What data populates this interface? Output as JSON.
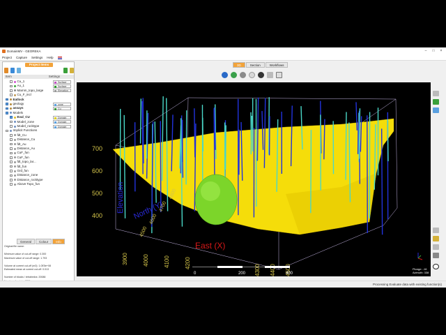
{
  "titlebar": {
    "title": "DomainMV - GEOREKA"
  },
  "menu": [
    "Project",
    "Capture",
    "Settings",
    "Help"
  ],
  "project_items": {
    "header": "Project Items"
  },
  "tree_columns": {
    "item": "Item",
    "settings": "Settings"
  },
  "tree": [
    {
      "label": "Cu_1",
      "checked": false,
      "indent": 1,
      "color": "#d24fd2",
      "setting": "Surface",
      "swatch": "#c050c0"
    },
    {
      "label": "Au_1",
      "checked": false,
      "indent": 1,
      "color": "#3aa83a",
      "setting": "Surface",
      "swatch": "#2a9a2a"
    },
    {
      "label": "Marnm_topo_large",
      "checked": false,
      "indent": 1,
      "color": "#8a8a8a",
      "setting": "Elevation",
      "swatch": "#999"
    },
    {
      "label": "Cu_F_incl",
      "checked": false,
      "indent": 1,
      "color": "#c29a55",
      "setting": "",
      "swatch": ""
    },
    {
      "label": "Eatlock",
      "checked": true,
      "indent": 0,
      "color": "#b58a3a",
      "bold": true,
      "setting": "",
      "swatch": ""
    },
    {
      "label": "geology",
      "checked": true,
      "indent": 0,
      "color": "#b58a3a",
      "setting": "zone",
      "swatch": "#5aa0e0"
    },
    {
      "label": "assays",
      "checked": true,
      "indent": 0,
      "color": "#b58a3a",
      "bold": true,
      "setting": "Cu",
      "swatch": "#3a9a3a"
    },
    {
      "label": "Models",
      "checked": true,
      "indent": 0,
      "color": "#6f8fc0",
      "setting": "",
      "swatch": ""
    },
    {
      "label": "Eval_CU",
      "checked": true,
      "indent": 1,
      "color": "#e0c030",
      "bold": true,
      "setting": "Domain",
      "swatch": "#e0d020"
    },
    {
      "label": "Model_zone",
      "checked": false,
      "indent": 1,
      "color": "#6f8fc0",
      "setting": "Domain",
      "swatch": "#5aa0e0"
    },
    {
      "label": "Model_rocktype",
      "checked": false,
      "indent": 1,
      "color": "#6f8fc0",
      "setting": "Domain",
      "swatch": "#5aa0e0"
    },
    {
      "label": "Implicit Functions",
      "checked": false,
      "indent": 0,
      "color": "#6f8fc0",
      "setting": "",
      "swatch": ""
    },
    {
      "label": "fdt_Cu",
      "checked": false,
      "indent": 1,
      "color": "#9a9a9a",
      "setting": "",
      "swatch": ""
    },
    {
      "label": "Distance_Cu",
      "checked": false,
      "indent": 1,
      "color": "#9a9a9a",
      "setting": "",
      "swatch": ""
    },
    {
      "label": "fdt_Au",
      "checked": false,
      "indent": 1,
      "color": "#9a9a9a",
      "setting": "",
      "swatch": ""
    },
    {
      "label": "Distance_Au",
      "checked": false,
      "indent": 1,
      "color": "#9a9a9a",
      "setting": "",
      "swatch": ""
    },
    {
      "label": "CuF_fun",
      "checked": false,
      "indent": 1,
      "color": "#9a9a9a",
      "setting": "",
      "swatch": ""
    },
    {
      "label": "CuF_fun",
      "checked": false,
      "indent": 1,
      "color": "#9a9a9a",
      "setting": "",
      "swatch": ""
    },
    {
      "label": "fdt_topo_lar...",
      "checked": false,
      "indent": 1,
      "color": "#9a9a9a",
      "setting": "",
      "swatch": ""
    },
    {
      "label": "fdt_fun",
      "checked": false,
      "indent": 1,
      "color": "#9a9a9a",
      "setting": "",
      "swatch": ""
    },
    {
      "label": "Grd_fun",
      "checked": false,
      "indent": 1,
      "color": "#9a9a9a",
      "setting": "",
      "swatch": ""
    },
    {
      "label": "Distance_zone",
      "checked": false,
      "indent": 1,
      "color": "#9a9a9a",
      "setting": "",
      "swatch": ""
    },
    {
      "label": "Distance_rocktype",
      "checked": false,
      "indent": 1,
      "color": "#9a9a9a",
      "setting": "",
      "swatch": ""
    },
    {
      "label": "Above Topo_fun",
      "checked": false,
      "indent": 1,
      "color": "#9a9a9a",
      "setting": "",
      "swatch": ""
    }
  ],
  "tabs": [
    {
      "label": "General",
      "active": false
    },
    {
      "label": "Colour",
      "active": false
    },
    {
      "label": "Info",
      "active": true
    }
  ],
  "info_lines": [
    "Original file name:",
    "",
    "Minimum value of cut-off range: 0.300",
    "Maximum value of cut-off range: 1.793",
    "",
    "Volume at current cut-off (m3): 1.0E5e+08",
    "Estimated mean at current cut-off: 0.013",
    "",
    "Number of blocks / tetrahedra: 20088",
    "Number of points: 4798"
  ],
  "view_tabs": [
    {
      "label": "3D",
      "active": true
    },
    {
      "label": "Section",
      "active": false
    },
    {
      "label": "Workflows",
      "active": false
    }
  ],
  "scene": {
    "elevation_ticks": [
      "700",
      "600",
      "500",
      "400"
    ],
    "elevation_label": "Elevation",
    "north_label": "North (Y)",
    "north_ticks": [
      "4800",
      "4700",
      "4600",
      "4500"
    ],
    "east_label": "East (X)",
    "east_ticks_left": [
      "3900",
      "4000",
      "4100",
      "4200"
    ],
    "east_ticks_right": [
      "4300",
      "4400",
      "4500"
    ],
    "scale_labels": [
      "200",
      "400"
    ],
    "scale_zero": "0",
    "plunge": "Plunge: -16",
    "azimuth": "Azimuth: 338",
    "colors": {
      "ore": "#f5dd0a",
      "shell": "#7cd52a",
      "drill_blue": "#2233dd",
      "drill_cyan": "#4ad8c8",
      "label_red": "#d81818",
      "label_blue": "#2a2ad8",
      "tick_yellow": "#d4c44a"
    }
  },
  "status": "Processing Evaluate data with existing function(s)"
}
